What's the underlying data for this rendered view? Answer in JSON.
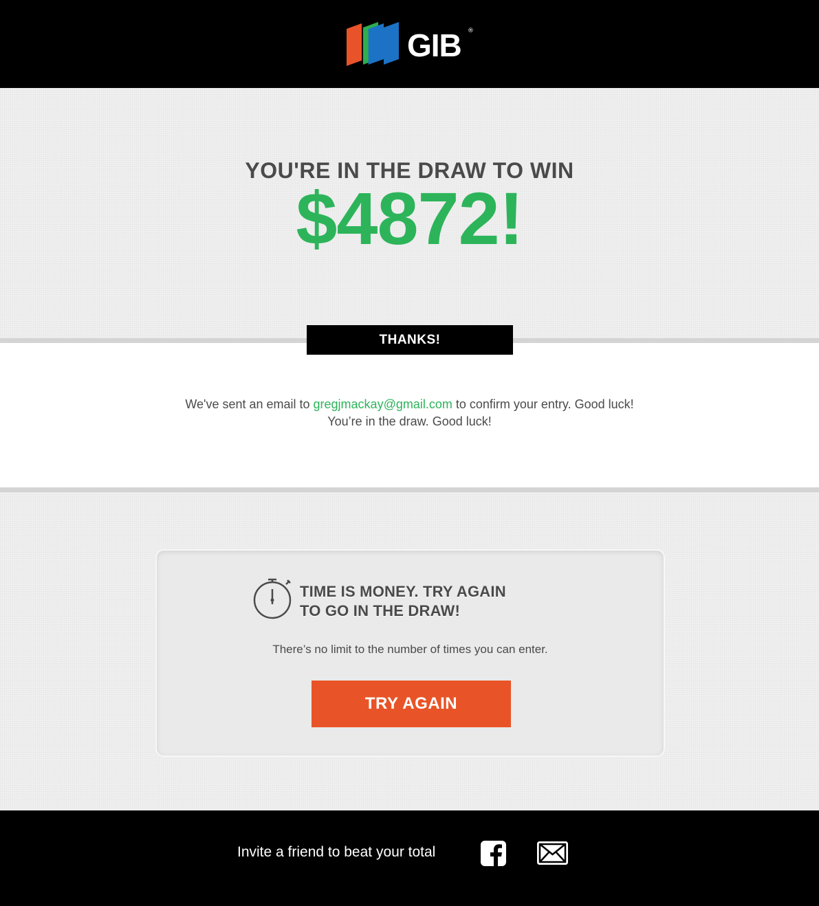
{
  "header": {
    "logo_text": "GIB",
    "logo_registered": "®",
    "logo_colors": [
      "#e8532a",
      "#2eae4f",
      "#1c72c4"
    ]
  },
  "hero": {
    "subtitle": "YOU'RE IN THE DRAW TO WIN",
    "amount": "$4872!"
  },
  "thanks_badge": "THANKS!",
  "confirmation": {
    "line1_prefix": "We've sent an email to ",
    "email": "gregjmackay@gmail.com",
    "line1_suffix": " to confirm your entry. Good luck!",
    "line2": "You’re in the draw. Good luck!"
  },
  "retry_card": {
    "icon": "stopwatch-icon",
    "title_line1": "TIME IS MONEY. TRY AGAIN",
    "title_line2": "TO GO IN THE DRAW!",
    "subtitle": "There’s no limit to the number of times you can enter.",
    "button_label": "TRY AGAIN"
  },
  "footer": {
    "invite_text": "Invite a friend to beat your total",
    "share_icons": [
      "facebook-icon",
      "mail-icon"
    ]
  },
  "colors": {
    "accent_green": "#2db45a",
    "button_orange": "#e85427",
    "header_bg": "#000000",
    "text_dark": "#4a4a4a"
  }
}
